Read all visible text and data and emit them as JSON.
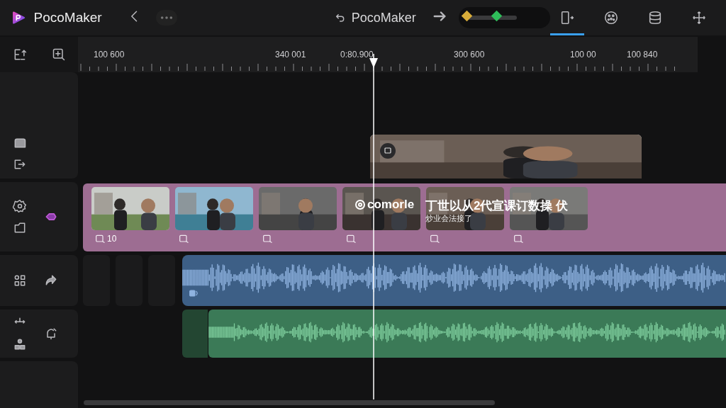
{
  "app": {
    "name": "PocoMaker"
  },
  "project": {
    "title": "PocoMaker"
  },
  "keyframe_slider": {
    "level": 0.6
  },
  "toolbar": [
    {
      "selected": true
    },
    {
      "selected": false
    },
    {
      "selected": false
    },
    {
      "selected": false
    }
  ],
  "ruler": {
    "labels": [
      "100 600",
      "340 001",
      "0:80.900",
      "300 600",
      "100 00",
      "100 840"
    ]
  },
  "video_track": {
    "clips": [
      {
        "kind": "picture",
        "badge": "10"
      },
      {
        "kind": "picture"
      },
      {
        "kind": "picture"
      },
      {
        "kind": "picture"
      },
      {
        "kind": "picture"
      },
      {
        "kind": "picture"
      }
    ],
    "overlay_brand": "comorle",
    "overlay_title": "丁世以从2代宣课订数操 伏",
    "overlay_subtitle": "炒业会法接了"
  }
}
